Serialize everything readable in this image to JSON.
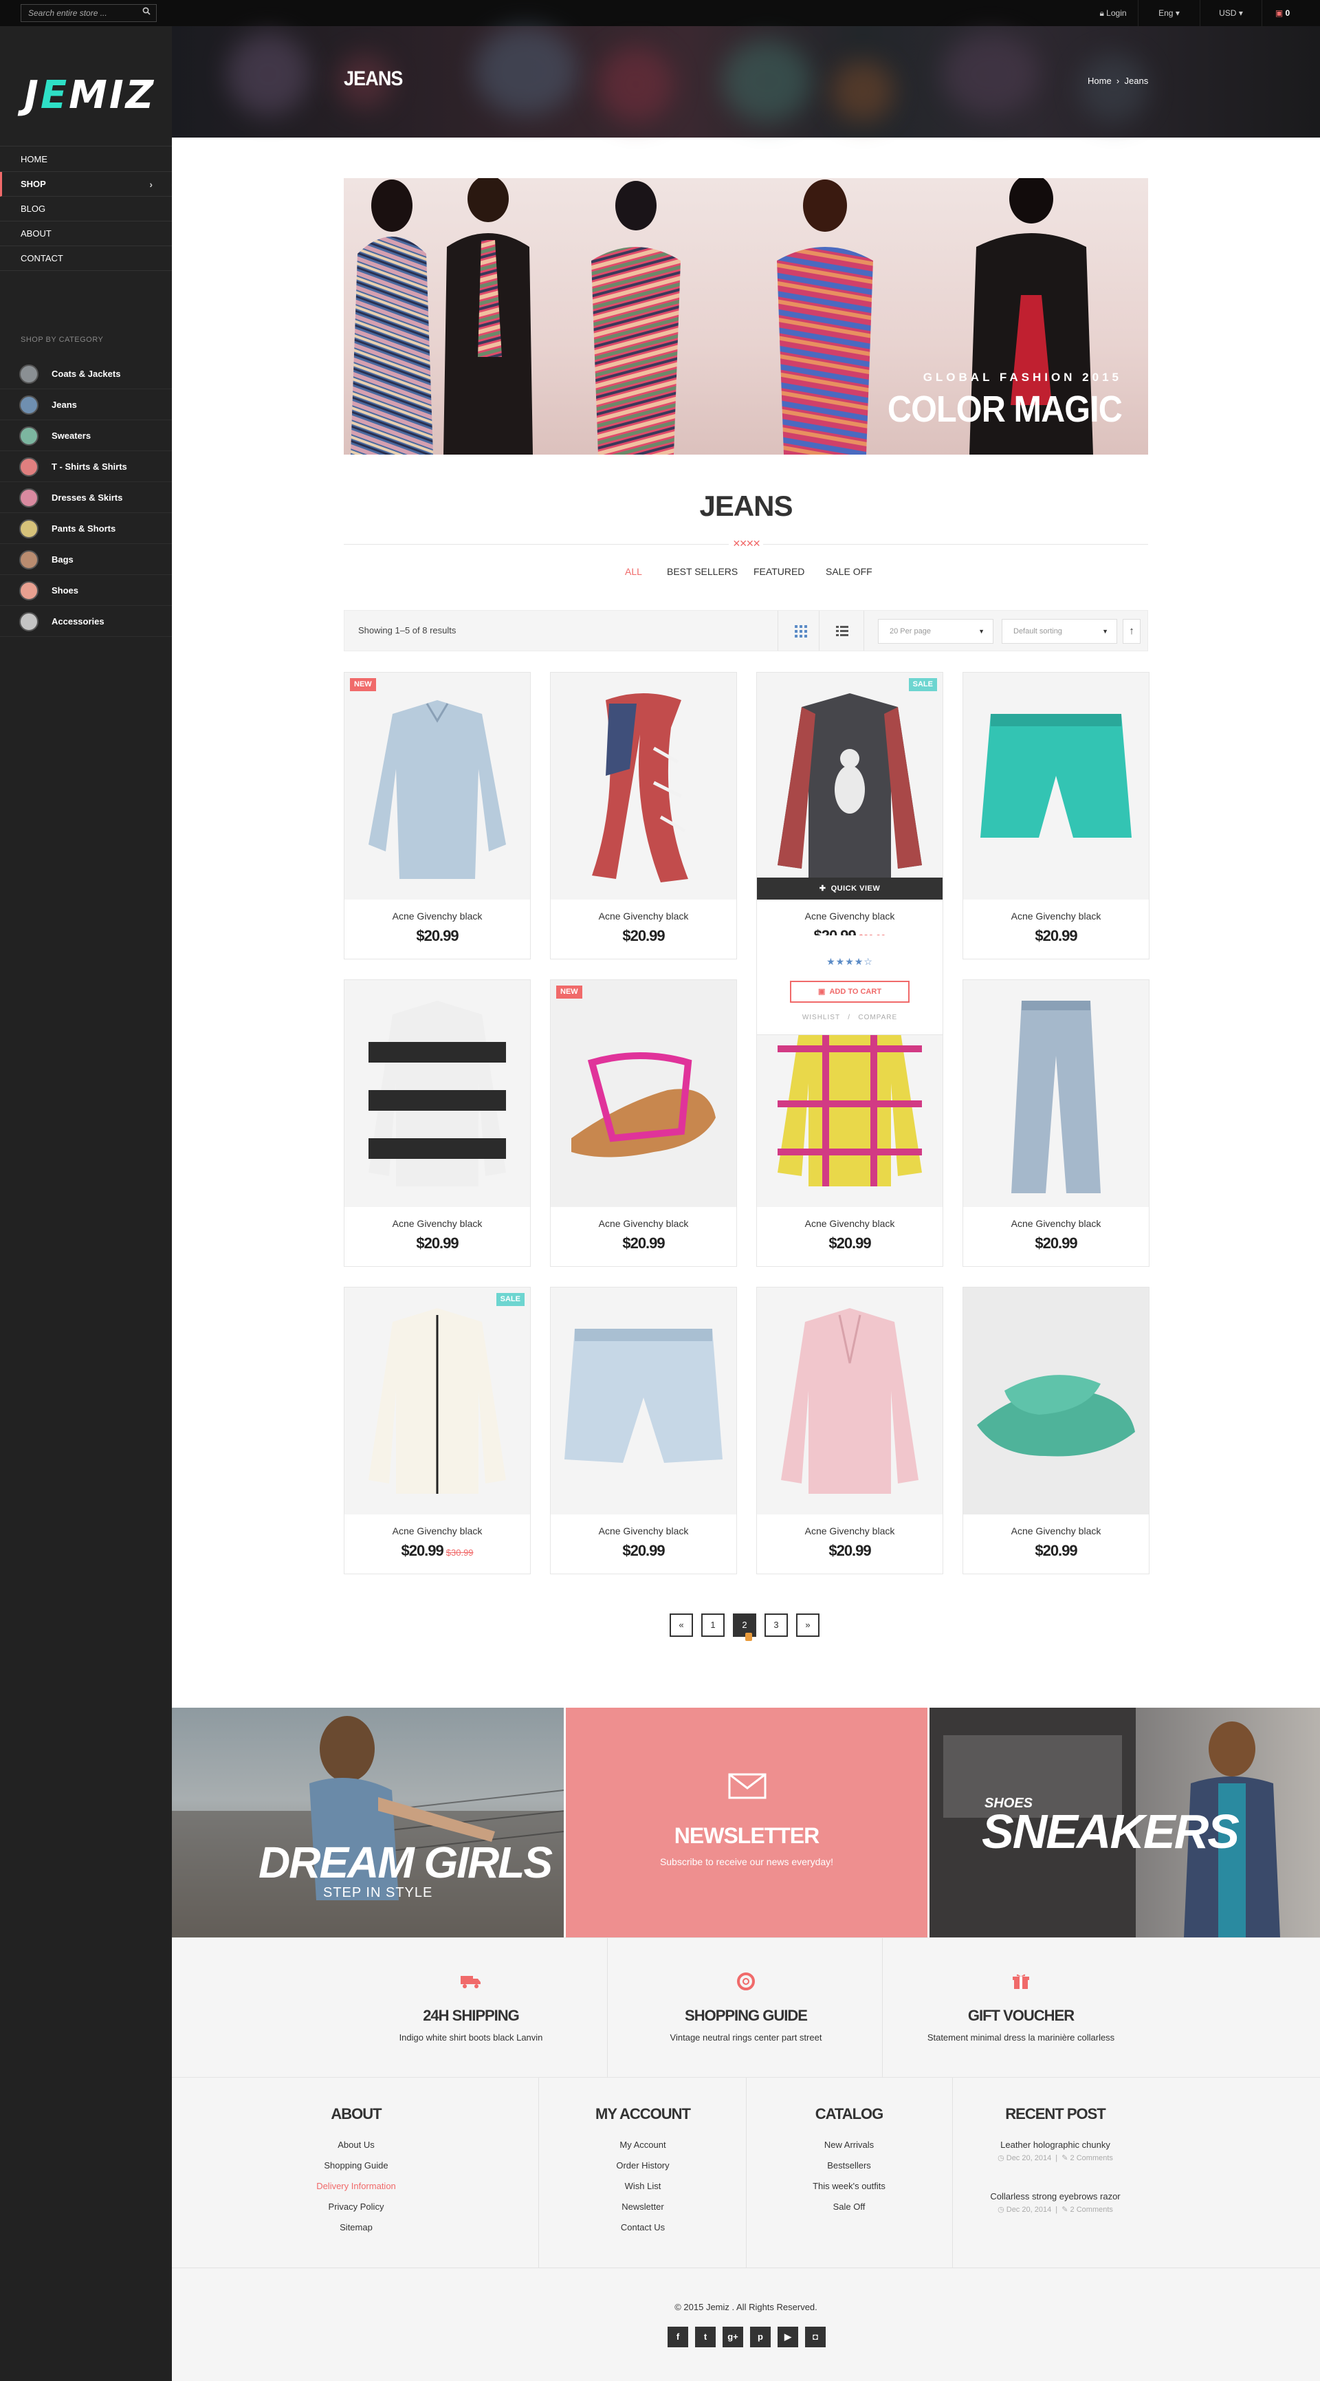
{
  "topbar": {
    "search_placeholder": "Search entire store ...",
    "login": "Login",
    "language": "Eng",
    "currency": "USD",
    "cart_count": "0"
  },
  "sidebar": {
    "logo_pre": "J",
    "logo_e": "E",
    "logo_post": "MIZ",
    "nav": [
      {
        "label": "HOME"
      },
      {
        "label": "SHOP"
      },
      {
        "label": "BLOG"
      },
      {
        "label": "ABOUT"
      },
      {
        "label": "CONTACT"
      }
    ],
    "category_title": "SHOP BY CATEGORY",
    "categories": [
      {
        "label": "Coats & Jackets",
        "color": "#8a8f93"
      },
      {
        "label": "Jeans",
        "color": "#6f8fb0"
      },
      {
        "label": "Sweaters",
        "color": "#7cb6a0"
      },
      {
        "label": "T - Shirts & Shirts",
        "color": "#e07f7f"
      },
      {
        "label": "Dresses & Skirts",
        "color": "#d98aa0"
      },
      {
        "label": "Pants & Shorts",
        "color": "#d6c27a"
      },
      {
        "label": "Bags",
        "color": "#b98c70"
      },
      {
        "label": "Shoes",
        "color": "#e8a090"
      },
      {
        "label": "Accessories",
        "color": "#c4c4c4"
      }
    ]
  },
  "header": {
    "title": "JEANS",
    "breadcrumb_home": "Home",
    "breadcrumb_sep": "›",
    "breadcrumb_current": "Jeans"
  },
  "banner": {
    "subtitle": "GLOBAL FASHION 2015",
    "title": "COLOR MAGIC"
  },
  "section": {
    "title": "JEANS",
    "filters": [
      "ALL",
      "BEST SELLERS",
      "FEATURED",
      "SALE OFF"
    ]
  },
  "toolbar": {
    "showing": "Showing 1–5 of 8 results",
    "per_page": "20 Per page",
    "sorting": "Default sorting"
  },
  "products": [
    {
      "name": "Acne Givenchy black",
      "price": "$20.99",
      "old": "",
      "badge": "NEW"
    },
    {
      "name": "Acne Givenchy black",
      "price": "$20.99",
      "old": "",
      "badge": ""
    },
    {
      "name": "Acne Givenchy black",
      "price": "$20.99",
      "old": "$30.99",
      "badge": "SALE"
    },
    {
      "name": "Acne Givenchy black",
      "price": "$20.99",
      "old": "",
      "badge": ""
    },
    {
      "name": "Acne Givenchy black",
      "price": "$20.99",
      "old": "",
      "badge": ""
    },
    {
      "name": "Acne Givenchy black",
      "price": "$20.99",
      "old": "",
      "badge": "NEW"
    },
    {
      "name": "Acne Givenchy black",
      "price": "$20.99",
      "old": "",
      "badge": ""
    },
    {
      "name": "Acne Givenchy black",
      "price": "$20.99",
      "old": "",
      "badge": ""
    },
    {
      "name": "Acne Givenchy black",
      "price": "$20.99",
      "old": "$30.99",
      "badge": "SALE"
    },
    {
      "name": "Acne Givenchy black",
      "price": "$20.99",
      "old": "",
      "badge": ""
    },
    {
      "name": "Acne Givenchy black",
      "price": "$20.99",
      "old": "",
      "badge": ""
    },
    {
      "name": "Acne Givenchy black",
      "price": "$20.99",
      "old": "",
      "badge": ""
    }
  ],
  "quick_view": {
    "label": "QUICK VIEW",
    "rating": 4.5,
    "add_to_cart": "ADD TO CART",
    "wishlist": "WISHLIST",
    "compare": "COMPARE",
    "sep": "/"
  },
  "pagination": [
    "«",
    "1",
    "2",
    "3",
    "»"
  ],
  "pagination_active": "2",
  "promos": {
    "dream_title": "DREAM GIRLS",
    "dream_sub": "STEP IN STYLE",
    "newsletter_title": "NEWSLETTER",
    "newsletter_sub": "Subscribe to receive our news everyday!",
    "sneakers_small": "SHOES",
    "sneakers_title": "SNEAKERS"
  },
  "services": [
    {
      "icon": "truck-icon",
      "title": "24H SHIPPING",
      "desc": "Indigo white shirt boots black Lanvin"
    },
    {
      "icon": "lifebuoy-icon",
      "title": "SHOPPING GUIDE",
      "desc": "Vintage neutral rings center part street"
    },
    {
      "icon": "gift-icon",
      "title": "GIFT VOUCHER",
      "desc": "Statement minimal dress la marinière collarless"
    }
  ],
  "footer": {
    "about": {
      "title": "ABOUT",
      "links": [
        "About Us",
        "Shopping Guide",
        "Delivery Information",
        "Privacy Policy",
        "Sitemap"
      ]
    },
    "account": {
      "title": "MY ACCOUNT",
      "links": [
        "My Account",
        "Order History",
        "Wish List",
        "Newsletter",
        "Contact Us"
      ]
    },
    "catalog": {
      "title": "CATALOG",
      "links": [
        "New Arrivals",
        "Bestsellers",
        "This week's outfits",
        "Sale Off"
      ]
    },
    "recent": {
      "title": "RECENT POST",
      "posts": [
        {
          "title": "Leather holographic chunky",
          "date": "Dec 20, 2014",
          "comments": "2 Comments"
        },
        {
          "title": "Collarless strong eyebrows razor",
          "date": "Dec 20, 2014",
          "comments": "2 Comments"
        }
      ]
    },
    "copyright": "© 2015 Jemiz . All Rights Reserved.",
    "social": [
      "f",
      "t",
      "g+",
      "p",
      "▶",
      "◘"
    ]
  },
  "colors": {
    "accent": "#f06a6a",
    "teal": "#2ee0c6",
    "sidebar": "#222222",
    "sale": "#6dd5d0"
  }
}
